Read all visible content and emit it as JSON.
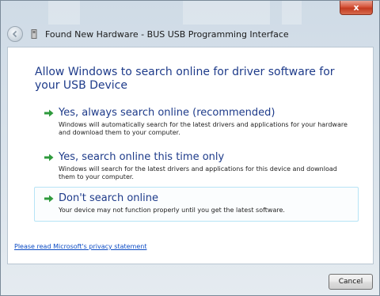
{
  "window": {
    "title": "Found New Hardware - BUS USB Programming Interface",
    "close_label": "x"
  },
  "heading": "Allow Windows to search online for driver software for your  USB Device",
  "options": [
    {
      "label": "Yes, always search online (recommended)",
      "description": "Windows will automatically search for the latest drivers and applications for your hardware and download them to your computer."
    },
    {
      "label": "Yes, search online this time only",
      "description": "Windows will search for the latest drivers and applications for this device and download them to your computer."
    },
    {
      "label": "Don't search online",
      "description": "Your device may not function properly until you get the latest software."
    }
  ],
  "privacy_link": "Please read Microsoft's  privacy statement",
  "cancel_label": "Cancel",
  "colors": {
    "link_blue": "#1e3b8a",
    "arrow_green": "#2e9a3c",
    "focus_border": "#b7e4f6"
  }
}
